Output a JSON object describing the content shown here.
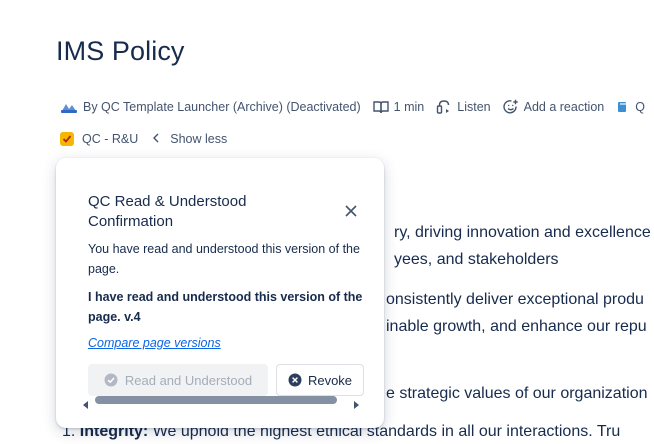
{
  "page": {
    "title": "IMS Policy"
  },
  "byline": {
    "author": "By QC Template Launcher (Archive) (Deactivated)",
    "read_time": "1 min",
    "listen": "Listen",
    "add_reaction": "Add a reaction",
    "overflow": "Q"
  },
  "meta": {
    "label": "QC - R&U",
    "show_less": "Show less"
  },
  "body_fragments": {
    "line1": "ry, driving innovation and excellence",
    "line2": "yees, and stakeholders",
    "line3": "onsistently deliver exceptional produ",
    "line4": "inable growth, and enhance our repu",
    "line5": "e strategic values of our organization",
    "list_number": "1.",
    "list_term": "Integrity:",
    "list_text": "We uphold the highest ethical standards in all our interactions. Tru"
  },
  "popup": {
    "title": "QC Read & Understood Confirmation",
    "description": "You have read and understood this version of the page.",
    "bold_text": "I have read and understood this version of the page. v.4",
    "compare_link": "Compare page versions",
    "read_button": "Read and Understood",
    "revoke_button": "Revoke"
  },
  "colors": {
    "link": "#0c66e4",
    "badge": "#f5b700",
    "text": "#172b4d",
    "muted": "#44546f"
  }
}
